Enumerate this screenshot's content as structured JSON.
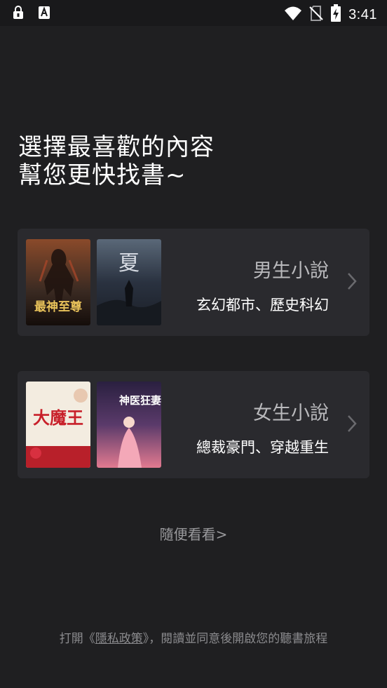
{
  "status_bar": {
    "time": "3:41",
    "left_icons": [
      "lock-notification-icon",
      "font-notification-icon"
    ],
    "right_icons": [
      "wifi-icon",
      "no-sim-icon",
      "battery-charging-icon"
    ]
  },
  "headline": {
    "line1": "選擇最喜歡的內容",
    "line2": "幫您更快找書~"
  },
  "categories": [
    {
      "title": "男生小說",
      "subtitle": "玄幻都市、歷史科幻",
      "covers": [
        {
          "title_text": "最神至尊",
          "colors": [
            "#3a2a22",
            "#c9a24a"
          ]
        },
        {
          "title_text": "夏",
          "colors": [
            "#2a3240",
            "#c8ccd4"
          ]
        }
      ]
    },
    {
      "title": "女生小說",
      "subtitle": "總裁豪門、穿越重生",
      "covers": [
        {
          "title_text": "大魔王",
          "colors": [
            "#f3ece0",
            "#c8202a"
          ]
        },
        {
          "title_text": "神医狂妻",
          "colors": [
            "#3a2a4a",
            "#f08aa0"
          ]
        }
      ]
    }
  ],
  "browse_label": "隨便看看>",
  "policy": {
    "prefix": "打開《",
    "link": "隱私政策",
    "suffix": "》，閱讀並同意後開啟您的聽書旅程"
  },
  "colors": {
    "background": "#1f1f21",
    "card": "#2a2a2e",
    "status_bar": "#19191b"
  }
}
